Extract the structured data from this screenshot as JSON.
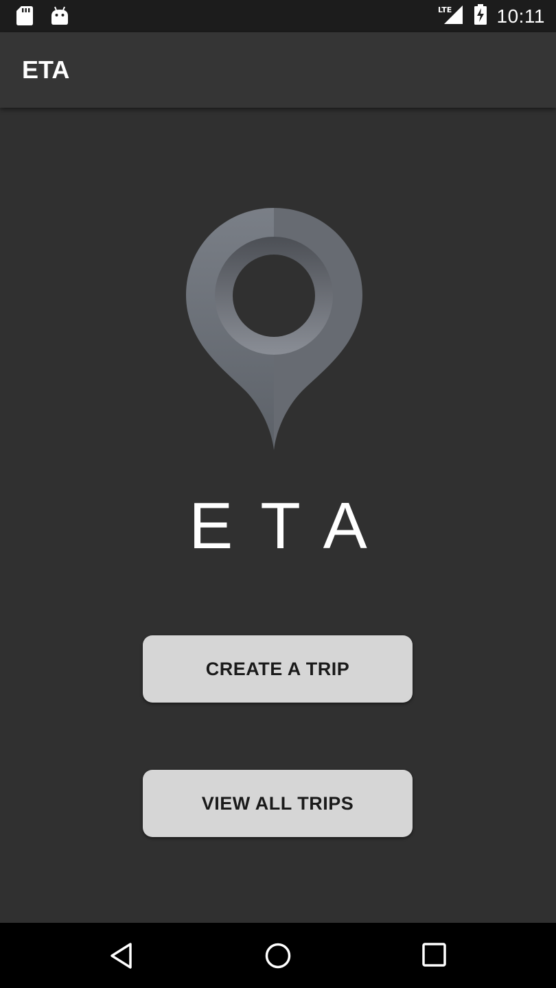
{
  "status_bar": {
    "icons_left": [
      "sd-card-icon",
      "android-debug-icon"
    ],
    "network": "LTE",
    "icons_right": [
      "lte-signal-icon",
      "battery-charging-icon"
    ],
    "time": "10:11"
  },
  "app_bar": {
    "title": "ETA"
  },
  "main": {
    "logo_icon": "location-pin-icon",
    "logo_text": "ETA",
    "create_trip_label": "CREATE A TRIP",
    "view_trips_label": "VIEW ALL TRIPS"
  },
  "nav_bar": {
    "icons": [
      "back-icon",
      "home-icon",
      "recents-icon"
    ]
  },
  "colors": {
    "background": "#303030",
    "status_bar": "#1c1c1c",
    "app_bar": "#353535",
    "button_bg": "#d6d6d6",
    "button_text": "#1a1a1a",
    "pin_light": "#7b7f87",
    "pin_dark": "#5e6269"
  }
}
